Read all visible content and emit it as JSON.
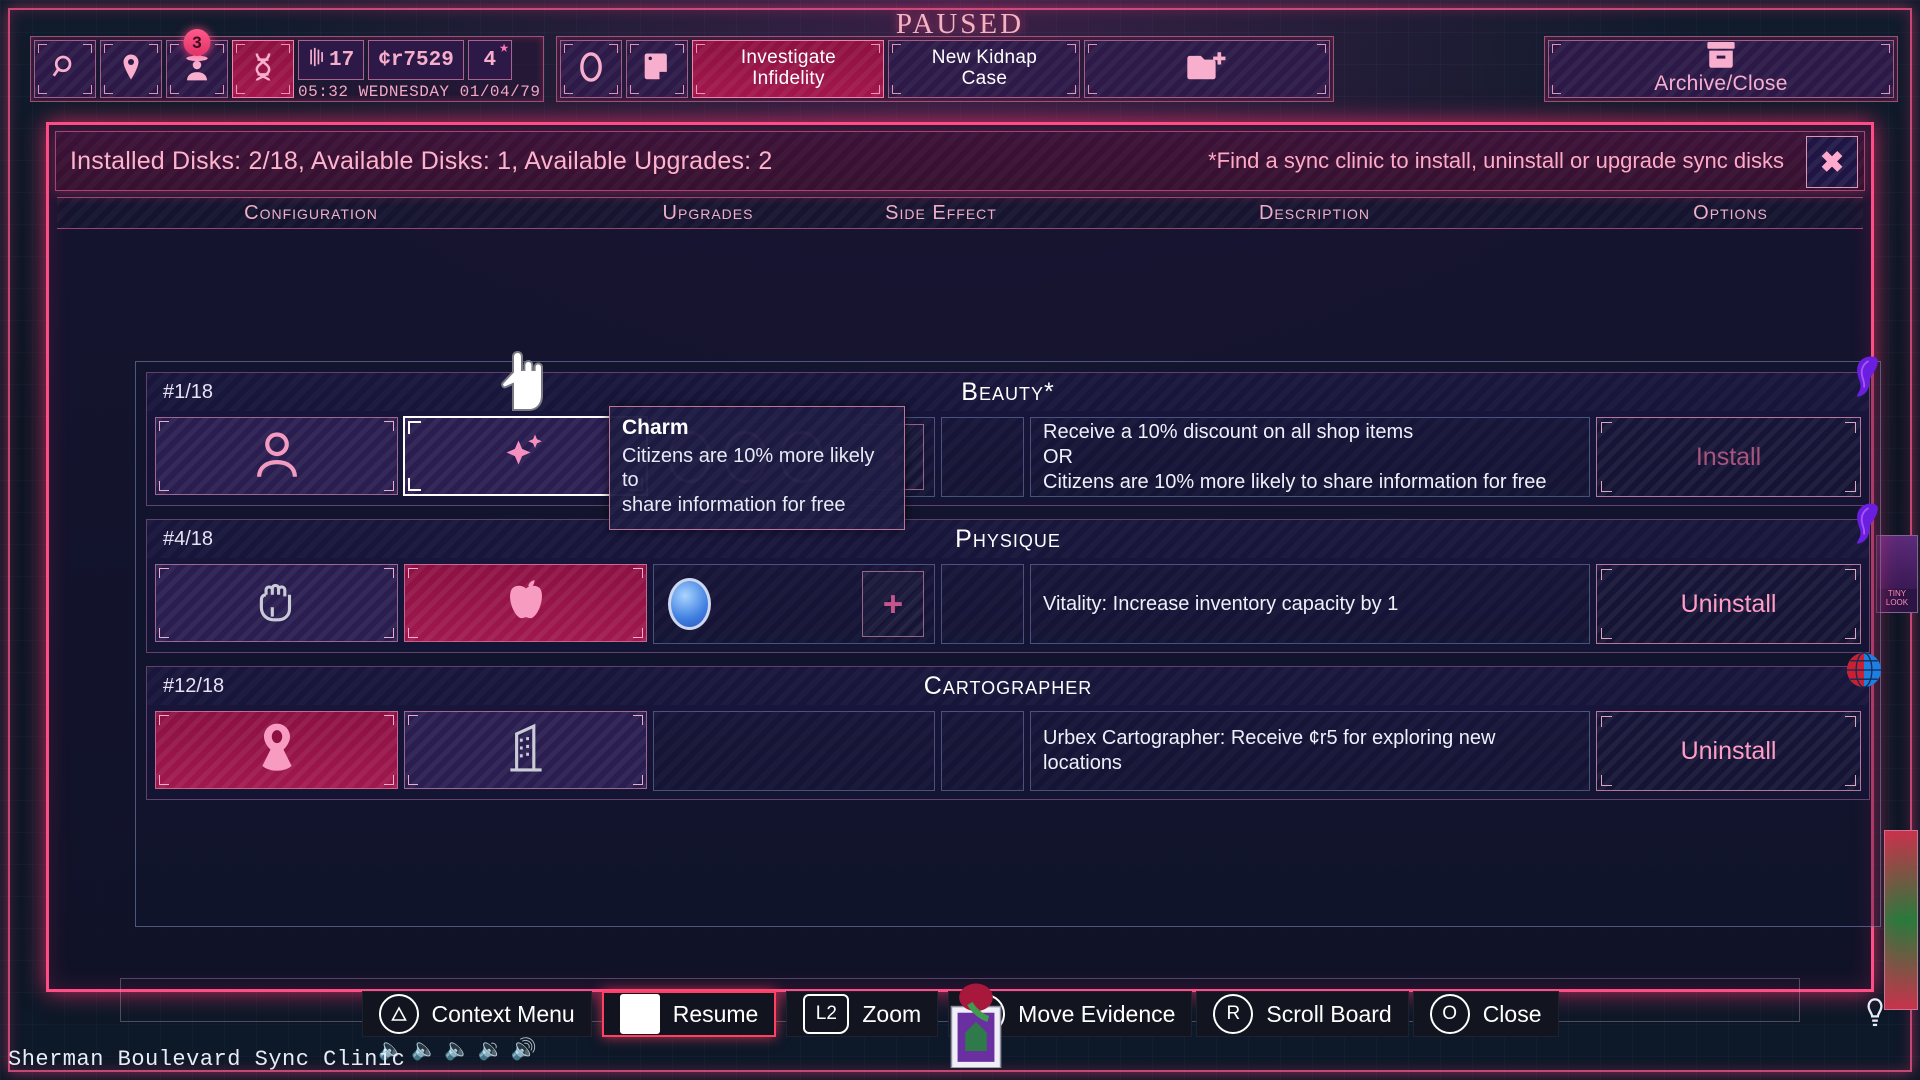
{
  "status": {
    "paused_label": "PAUSED",
    "location": "Sherman Boulevard Sync Clinic"
  },
  "toolbar": {
    "icon_buttons": [
      {
        "name": "search-icon",
        "glyph": "⚲",
        "badge": null,
        "accent": false
      },
      {
        "name": "map-pin-icon",
        "glyph": "⚑",
        "badge": null,
        "accent": false
      },
      {
        "name": "detective-icon",
        "glyph": "♙",
        "badge": "3",
        "accent": false
      },
      {
        "name": "dna-icon",
        "glyph": "ⸯ",
        "badge": null,
        "accent": true
      }
    ],
    "stats": [
      {
        "name": "fingerprint-count",
        "icon": "fingerprint-icon",
        "value": "17"
      },
      {
        "name": "credits",
        "icon": "credit-icon",
        "value": "¢r7529"
      },
      {
        "name": "rating",
        "icon": "star-icon",
        "value": "4"
      }
    ],
    "clock": "05:32 WEDNESDAY 01/04/79",
    "second_group": [
      {
        "name": "handcuff-icon",
        "glyph": "O",
        "label": ""
      },
      {
        "name": "notebook-icon",
        "glyph": "❐",
        "label": ""
      }
    ],
    "cases": [
      {
        "name": "investigate-infidelity",
        "label": "Investigate\nInfidelity",
        "accent": true
      },
      {
        "name": "new-kidnap-case",
        "label": "New Kidnap\nCase",
        "accent": false
      },
      {
        "name": "new-case-folder",
        "glyph": "🗁",
        "label": "",
        "accent": false
      }
    ],
    "archive": {
      "label": "Archive/Close",
      "icon": "archive-box-icon"
    }
  },
  "modal": {
    "title": "Installed Disks: 2/18, Available Disks: 1, Available Upgrades: 2",
    "note": "*Find a sync clinic to install, uninstall or upgrade sync disks",
    "close_glyph": "✖",
    "columns": [
      "Configuration",
      "Upgrades",
      "Side Effect",
      "Description",
      "Options"
    ],
    "disks": [
      {
        "number": "#1/18",
        "name": "Beauty*",
        "logo": "beauty-face-icon",
        "slots": [
          {
            "name": "person-icon",
            "filled": false,
            "selected": false,
            "glyph": "person"
          },
          {
            "name": "sparkle-icon",
            "filled": false,
            "selected": true,
            "glyph": "sparkle"
          }
        ],
        "upgrades": [
          {
            "active": false
          },
          {
            "active": false
          },
          {
            "active": false
          }
        ],
        "upgrade_add_label": "+",
        "side_effect": "",
        "description": "Receive a 10% discount on all shop items\nOR\nCitizens are 10% more likely to share information for free",
        "option_label": "Install",
        "option_state": "disabled"
      },
      {
        "number": "#4/18",
        "name": "Physique",
        "logo": "beauty-face-icon",
        "slots": [
          {
            "name": "fist-icon",
            "filled": false,
            "selected": false,
            "glyph": "fist"
          },
          {
            "name": "apple-icon",
            "filled": true,
            "selected": false,
            "glyph": "apple"
          }
        ],
        "upgrades": [
          {
            "active": true
          }
        ],
        "upgrade_add_label": "+",
        "side_effect": "",
        "description": "Vitality: Increase inventory capacity by 1",
        "option_label": "Uninstall",
        "option_state": "enabled"
      },
      {
        "number": "#12/18",
        "name": "Cartographer",
        "logo": "globe-icon",
        "slots": [
          {
            "name": "map-pin-icon",
            "filled": true,
            "selected": false,
            "glyph": "pin"
          },
          {
            "name": "building-icon",
            "filled": false,
            "selected": false,
            "glyph": "building"
          }
        ],
        "upgrades": [],
        "upgrade_add_label": "",
        "side_effect": "",
        "description": "Urbex Cartographer: Receive ¢r5 for exploring new locations",
        "option_label": "Uninstall",
        "option_state": "enabled"
      }
    ]
  },
  "tooltip": {
    "title": "Charm",
    "body": "Citizens are 10% more likely to\nshare information for free"
  },
  "bottom_hints": [
    {
      "name": "context-menu",
      "button": "△",
      "shape": "circle",
      "label": "Context Menu",
      "primary": false
    },
    {
      "name": "resume",
      "button": "",
      "shape": "square",
      "label": "Resume",
      "primary": true
    },
    {
      "name": "zoom",
      "button": "L2",
      "shape": "l2",
      "label": "Zoom",
      "primary": false
    },
    {
      "name": "move-evidence",
      "button": "L",
      "shape": "circle",
      "label": "Move Evidence",
      "primary": false
    },
    {
      "name": "scroll-board",
      "button": "R",
      "shape": "circle",
      "label": "Scroll Board",
      "primary": false
    },
    {
      "name": "close",
      "button": "O",
      "shape": "circle",
      "label": "Close",
      "primary": false
    }
  ],
  "colors": {
    "neon_pink": "#ff4d85",
    "accent_crimson": "#a0184d",
    "panel_purple": "#2c1e52",
    "text_pink": "#ffb3cd",
    "blue_upgrade": "#3f7fe0"
  }
}
